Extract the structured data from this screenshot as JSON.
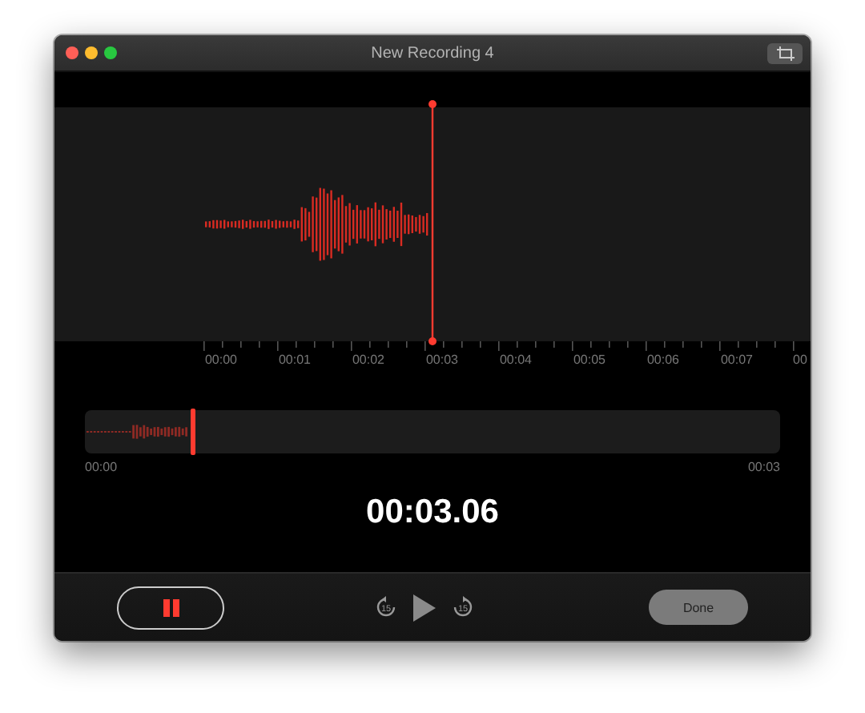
{
  "window": {
    "title": "New Recording 4"
  },
  "timeline": {
    "labels": [
      "00:00",
      "00:01",
      "00:02",
      "00:03",
      "00:04",
      "00:05",
      "00:06",
      "00:07",
      "00"
    ]
  },
  "overview": {
    "start": "00:00",
    "end": "00:03"
  },
  "timer": "00:03.06",
  "controls": {
    "skip_back": "15",
    "skip_forward": "15",
    "done": "Done"
  }
}
